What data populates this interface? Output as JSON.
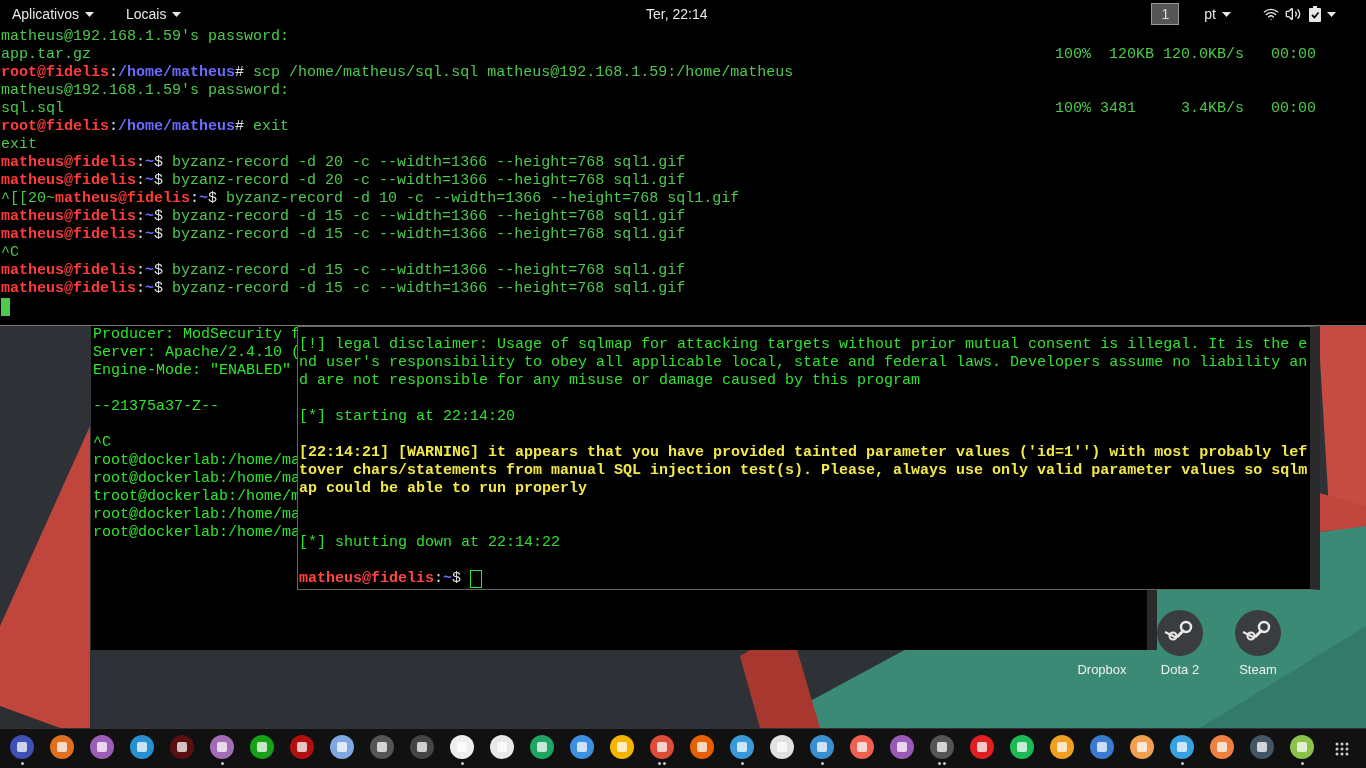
{
  "top_bar": {
    "menus": [
      {
        "label": "Aplicativos"
      },
      {
        "label": "Locais"
      }
    ],
    "clock": "Ter, 22:14",
    "workspace": "1",
    "language": "pt"
  },
  "top_terminal": {
    "cursor": true,
    "lines": [
      {
        "text": "matheus@192.168.1.59's password:"
      },
      {
        "text": "app.tar.gz",
        "transfer": "100%  120KB 120.0KB/s   00:00"
      },
      {
        "prompt": {
          "user_host": "root@fidelis",
          "sep": ":",
          "path": "/home/matheus",
          "symbol": "#"
        },
        "text": "scp /home/matheus/sql.sql matheus@192.168.1.59:/home/matheus"
      },
      {
        "text": "matheus@192.168.1.59's password:"
      },
      {
        "text": "sql.sql",
        "transfer": "100% 3481     3.4KB/s   00:00"
      },
      {
        "prompt": {
          "user_host": "root@fidelis",
          "sep": ":",
          "path": "/home/matheus",
          "symbol": "#"
        },
        "text": "exit"
      },
      {
        "text": "exit"
      },
      {
        "prompt": {
          "user_host": "matheus@fidelis",
          "sep": ":",
          "path": "~",
          "symbol": "$"
        },
        "text": "byzanz-record -d 20 -c --width=1366 --height=768 sql1.gif"
      },
      {
        "prompt": {
          "user_host": "matheus@fidelis",
          "sep": ":",
          "path": "~",
          "symbol": "$"
        },
        "text": "byzanz-record -d 20 -c --width=1366 --height=768 sql1.gif"
      },
      {
        "prompt": {
          "prefix": "^[[20~",
          "user_host": "matheus@fidelis",
          "sep": ":",
          "path": "~",
          "symbol": "$"
        },
        "text": "byzanz-record -d 10 -c --width=1366 --height=768 sql1.gif"
      },
      {
        "prompt": {
          "user_host": "matheus@fidelis",
          "sep": ":",
          "path": "~",
          "symbol": "$"
        },
        "text": "byzanz-record -d 15 -c --width=1366 --height=768 sql1.gif"
      },
      {
        "prompt": {
          "user_host": "matheus@fidelis",
          "sep": ":",
          "path": "~",
          "symbol": "$"
        },
        "text": "byzanz-record -d 15 -c --width=1366 --height=768 sql1.gif"
      },
      {
        "text": "^C"
      },
      {
        "prompt": {
          "user_host": "matheus@fidelis",
          "sep": ":",
          "path": "~",
          "symbol": "$"
        },
        "text": "byzanz-record -d 15 -c --width=1366 --height=768 sql1.gif"
      },
      {
        "prompt": {
          "user_host": "matheus@fidelis",
          "sep": ":",
          "path": "~",
          "symbol": "$"
        },
        "text": "byzanz-record -d 15 -c --width=1366 --height=768 sql1.gif"
      }
    ]
  },
  "back_terminal": {
    "lines": [
      {
        "kind": "text",
        "text": "Producer: ModSecurity f"
      },
      {
        "kind": "text",
        "text": "Server: Apache/2.4.10 ("
      },
      {
        "kind": "text",
        "text": "Engine-Mode: \"ENABLED\""
      },
      {
        "kind": "blank"
      },
      {
        "kind": "text",
        "text": "--21375a37-Z--"
      },
      {
        "kind": "blank"
      },
      {
        "kind": "text",
        "text": "^C"
      },
      {
        "kind": "text",
        "text": "root@dockerlab:/home/ma"
      },
      {
        "kind": "text",
        "text": "root@dockerlab:/home/ma"
      },
      {
        "kind": "text",
        "text": "troot@dockerlab:/home/m"
      },
      {
        "kind": "text",
        "text": "root@dockerlab:/home/ma"
      },
      {
        "kind": "text",
        "text": "root@dockerlab:/home/ma"
      }
    ]
  },
  "front_terminal": {
    "blocks": [
      {
        "kind": "info",
        "text": "[!] legal disclaimer: Usage of sqlmap for attacking targets without prior mutual consent is illegal. It is the end user's responsibility to obey all applicable local, state and federal laws. Developers assume no liability and are not responsible for any misuse or damage caused by this program"
      },
      {
        "kind": "blank"
      },
      {
        "kind": "info",
        "text": "[*] starting at 22:14:20"
      },
      {
        "kind": "blank"
      },
      {
        "kind": "warning",
        "text": "[22:14:21] [WARNING] it appears that you have provided tainted parameter values ('id=1'') with most probably leftover chars/statements from manual SQL injection test(s). Please, always use only valid parameter values so sqlmap could be able to run properly"
      },
      {
        "kind": "blank"
      },
      {
        "kind": "blank"
      },
      {
        "kind": "info",
        "text": "[*] shutting down at 22:14:22"
      },
      {
        "kind": "blank"
      }
    ],
    "prompt": {
      "user_host": "matheus@fidelis",
      "sep": ":",
      "path": "~",
      "symbol": "$"
    },
    "cursor": true
  },
  "desktop_icons": [
    {
      "label": "Dropbox",
      "kind": "hidden"
    },
    {
      "label": "Dota 2",
      "kind": "steam"
    },
    {
      "label": "Steam",
      "kind": "steam"
    }
  ],
  "dock": {
    "items": [
      {
        "color": "#3f51b5",
        "running": true,
        "multiple": false
      },
      {
        "color": "#e07020",
        "running": false
      },
      {
        "color": "#9c5fb5",
        "running": false
      },
      {
        "color": "#2a8fd0",
        "running": false
      },
      {
        "color": "#5a1010",
        "running": false
      },
      {
        "color": "#a46cb5",
        "running": true,
        "multiple": false
      },
      {
        "color": "#19a019",
        "running": false
      },
      {
        "color": "#b01010",
        "running": false
      },
      {
        "color": "#7fa8e0",
        "running": false
      },
      {
        "color": "#555555",
        "running": false
      },
      {
        "color": "#444444",
        "running": false
      },
      {
        "color": "#eeeeee",
        "running": true,
        "multiple": false
      },
      {
        "color": "#e8e8e8",
        "running": false
      },
      {
        "color": "#1fa463",
        "running": false
      },
      {
        "color": "#3d8fe0",
        "running": false
      },
      {
        "color": "#f4b400",
        "running": false
      },
      {
        "color": "#dd4b39",
        "running": true,
        "multiple": true
      },
      {
        "color": "#e66000",
        "running": false
      },
      {
        "color": "#3a9ad9",
        "running": true,
        "multiple": false
      },
      {
        "color": "#e0e0e0",
        "running": false
      },
      {
        "color": "#3a8fd0",
        "running": true,
        "multiple": false
      },
      {
        "color": "#f06050",
        "running": false
      },
      {
        "color": "#9b59b6",
        "running": false
      },
      {
        "color": "#555555",
        "running": true,
        "multiple": true
      },
      {
        "color": "#e02020",
        "running": false
      },
      {
        "color": "#1db954",
        "running": false
      },
      {
        "color": "#f0a020",
        "running": false
      },
      {
        "color": "#3a7ad0",
        "running": false
      },
      {
        "color": "#f0a050",
        "running": false
      },
      {
        "color": "#3aa0e0",
        "running": true,
        "multiple": false
      },
      {
        "color": "#f08040",
        "running": false
      },
      {
        "color": "#445566",
        "running": false
      },
      {
        "color": "#8bc34a",
        "running": true,
        "multiple": false
      }
    ]
  }
}
